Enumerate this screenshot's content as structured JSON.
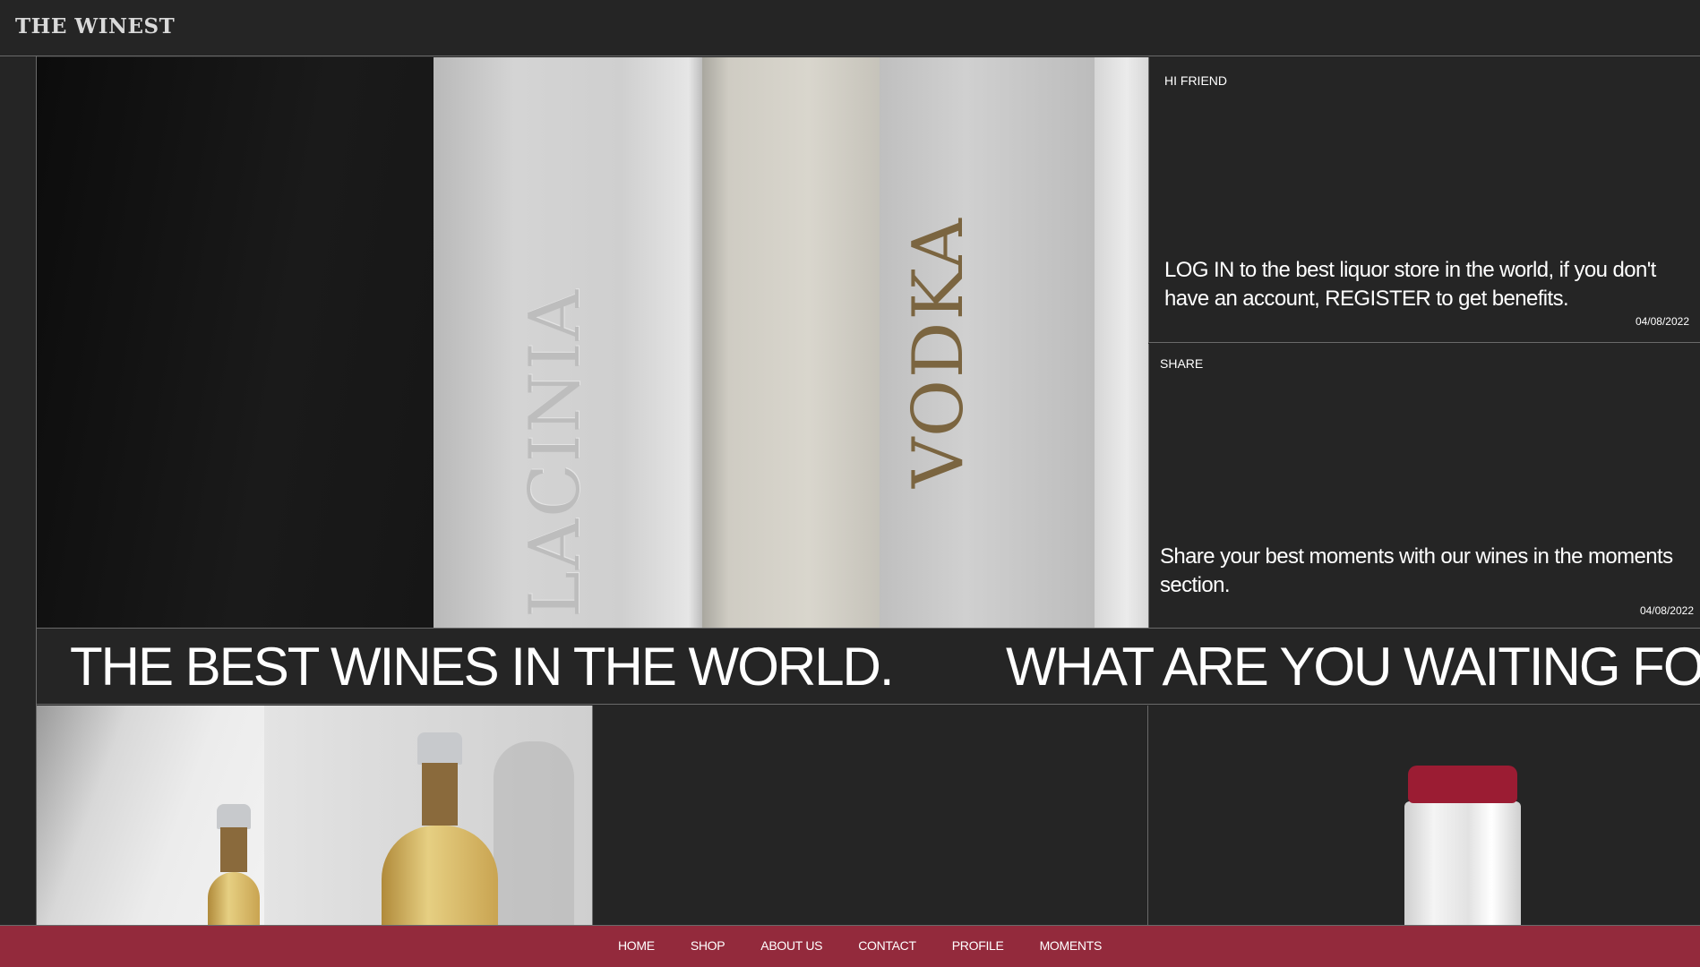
{
  "header": {
    "logo": "THE WINEST"
  },
  "hero": {
    "bottle_labels": [
      "LACINIA",
      "VODKA"
    ]
  },
  "panels": [
    {
      "tag": "HI FRIEND",
      "message": "LOG IN to the best liquor store in the world, if you don't have an account, REGISTER to get benefits.",
      "date": "04/08/2022"
    },
    {
      "tag": "SHARE",
      "message": "Share your best moments with our wines in the moments section.",
      "date": "04/08/2022"
    }
  ],
  "marquee": {
    "line1": "THE BEST WINES IN THE WORLD.",
    "line2": "WHAT ARE YOU WAITING FOR"
  },
  "nav": {
    "items": [
      "HOME",
      "SHOP",
      "ABOUT US",
      "CONTACT",
      "PROFILE",
      "MOMENTS"
    ]
  },
  "colors": {
    "background": "#252525",
    "accent": "#932a3c",
    "border": "#6a6a6a"
  }
}
